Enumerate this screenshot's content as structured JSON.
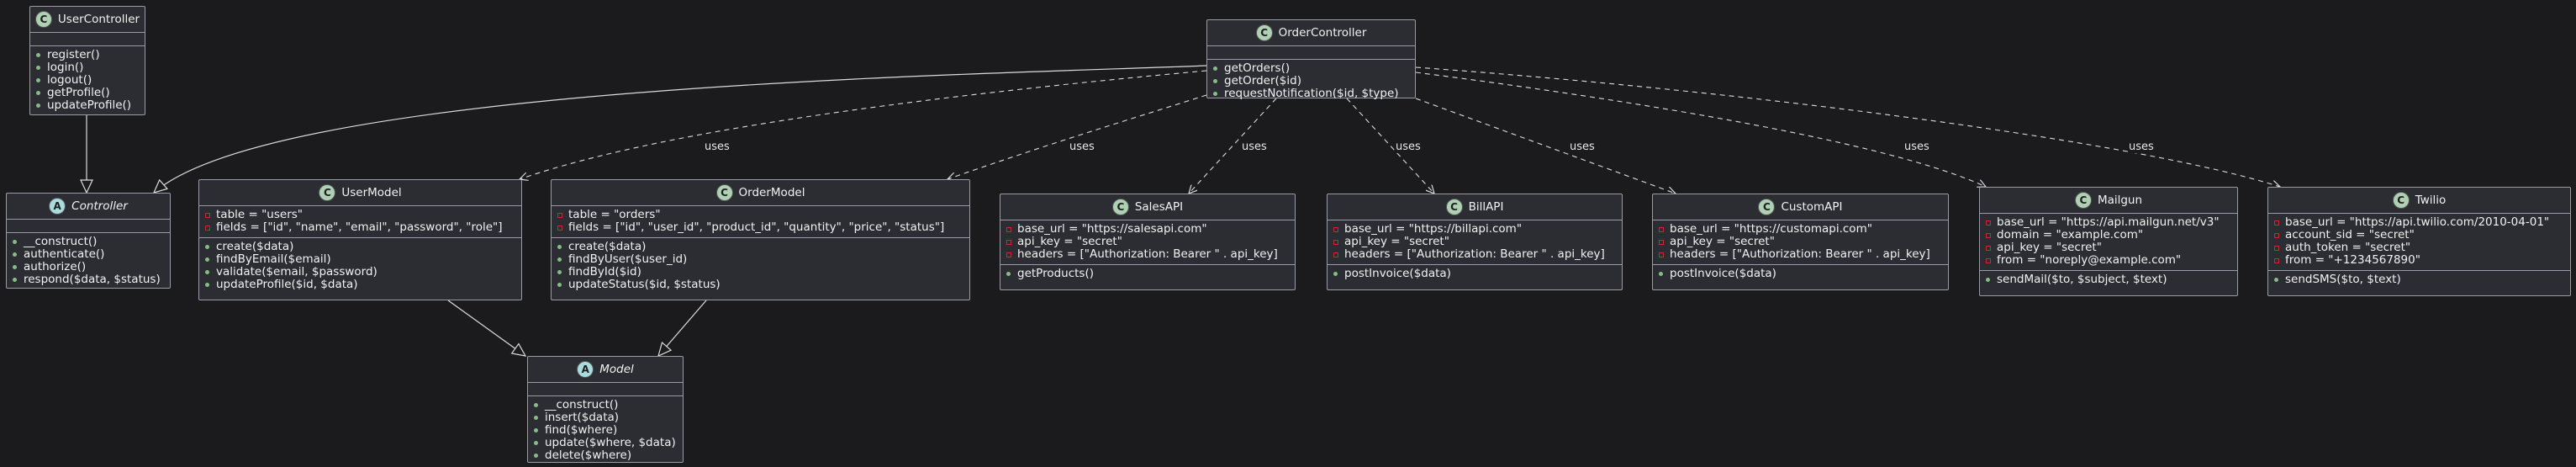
{
  "diagram": {
    "classes": {
      "user_controller": {
        "name": "UserController",
        "kind": "class",
        "fields": [],
        "methods": [
          {
            "vis": "public",
            "text": "register()"
          },
          {
            "vis": "public",
            "text": "login()"
          },
          {
            "vis": "public",
            "text": "logout()"
          },
          {
            "vis": "public",
            "text": "getProfile()"
          },
          {
            "vis": "public",
            "text": "updateProfile()"
          }
        ]
      },
      "controller": {
        "name": "Controller",
        "kind": "abstract",
        "fields": [],
        "methods": [
          {
            "vis": "public",
            "text": "__construct()"
          },
          {
            "vis": "public",
            "text": "authenticate()"
          },
          {
            "vis": "public",
            "text": "authorize()"
          },
          {
            "vis": "public",
            "text": "respond($data, $status)"
          }
        ]
      },
      "order_controller": {
        "name": "OrderController",
        "kind": "class",
        "fields": [],
        "methods": [
          {
            "vis": "public",
            "text": "getOrders()"
          },
          {
            "vis": "public",
            "text": "getOrder($id)"
          },
          {
            "vis": "public",
            "text": "requestNotification($id, $type)"
          }
        ]
      },
      "user_model": {
        "name": "UserModel",
        "kind": "class",
        "fields": [
          {
            "vis": "private",
            "text": "table = \"users\""
          },
          {
            "vis": "private",
            "text": "fields = [\"id\", \"name\", \"email\", \"password\", \"role\"]"
          }
        ],
        "methods": [
          {
            "vis": "public",
            "text": "create($data)"
          },
          {
            "vis": "public",
            "text": "findByEmail($email)"
          },
          {
            "vis": "public",
            "text": "validate($email, $password)"
          },
          {
            "vis": "public",
            "text": "updateProfile($id, $data)"
          }
        ]
      },
      "order_model": {
        "name": "OrderModel",
        "kind": "class",
        "fields": [
          {
            "vis": "private",
            "text": "table = \"orders\""
          },
          {
            "vis": "private",
            "text": "fields = [\"id\", \"user_id\", \"product_id\", \"quantity\", \"price\", \"status\"]"
          }
        ],
        "methods": [
          {
            "vis": "public",
            "text": "create($data)"
          },
          {
            "vis": "public",
            "text": "findByUser($user_id)"
          },
          {
            "vis": "public",
            "text": "findById($id)"
          },
          {
            "vis": "public",
            "text": "updateStatus($id, $status)"
          }
        ]
      },
      "model": {
        "name": "Model",
        "kind": "abstract",
        "fields": [],
        "methods": [
          {
            "vis": "public",
            "text": "__construct()"
          },
          {
            "vis": "public",
            "text": "insert($data)"
          },
          {
            "vis": "public",
            "text": "find($where)"
          },
          {
            "vis": "public",
            "text": "update($where, $data)"
          },
          {
            "vis": "public",
            "text": "delete($where)"
          }
        ]
      },
      "sales_api": {
        "name": "SalesAPI",
        "kind": "class",
        "fields": [
          {
            "vis": "private",
            "text": "base_url = \"https://salesapi.com\""
          },
          {
            "vis": "private",
            "text": "api_key = \"secret\""
          },
          {
            "vis": "private",
            "text": "headers = [\"Authorization: Bearer \" . api_key]"
          }
        ],
        "methods": [
          {
            "vis": "public",
            "text": "getProducts()"
          }
        ]
      },
      "bill_api": {
        "name": "BillAPI",
        "kind": "class",
        "fields": [
          {
            "vis": "private",
            "text": "base_url = \"https://billapi.com\""
          },
          {
            "vis": "private",
            "text": "api_key = \"secret\""
          },
          {
            "vis": "private",
            "text": "headers = [\"Authorization: Bearer \" . api_key]"
          }
        ],
        "methods": [
          {
            "vis": "public",
            "text": "postInvoice($data)"
          }
        ]
      },
      "custom_api": {
        "name": "CustomAPI",
        "kind": "class",
        "fields": [
          {
            "vis": "private",
            "text": "base_url = \"https://customapi.com\""
          },
          {
            "vis": "private",
            "text": "api_key = \"secret\""
          },
          {
            "vis": "private",
            "text": "headers = [\"Authorization: Bearer \" . api_key]"
          }
        ],
        "methods": [
          {
            "vis": "public",
            "text": "postInvoice($data)"
          }
        ]
      },
      "mailgun": {
        "name": "Mailgun",
        "kind": "class",
        "fields": [
          {
            "vis": "private",
            "text": "base_url = \"https://api.mailgun.net/v3\""
          },
          {
            "vis": "private",
            "text": "domain = \"example.com\""
          },
          {
            "vis": "private",
            "text": "api_key = \"secret\""
          },
          {
            "vis": "private",
            "text": "from = \"noreply@example.com\""
          }
        ],
        "methods": [
          {
            "vis": "public",
            "text": "sendMail($to, $subject, $text)"
          }
        ]
      },
      "twilio": {
        "name": "Twilio",
        "kind": "class",
        "fields": [
          {
            "vis": "private",
            "text": "base_url = \"https://api.twilio.com/2010-04-01\""
          },
          {
            "vis": "private",
            "text": "account_sid = \"secret\""
          },
          {
            "vis": "private",
            "text": "auth_token = \"secret\""
          },
          {
            "vis": "private",
            "text": "from = \"+1234567890\""
          }
        ],
        "methods": [
          {
            "vis": "public",
            "text": "sendSMS($to, $text)"
          }
        ]
      }
    },
    "relations": [
      {
        "type": "inheritance",
        "from": "user_controller",
        "to": "controller"
      },
      {
        "type": "inheritance",
        "from": "order_controller",
        "to": "controller"
      },
      {
        "type": "inheritance",
        "from": "user_model",
        "to": "model"
      },
      {
        "type": "inheritance",
        "from": "order_model",
        "to": "model"
      },
      {
        "type": "dependency",
        "from": "order_controller",
        "to": "user_model",
        "label": "uses"
      },
      {
        "type": "dependency",
        "from": "order_controller",
        "to": "order_model",
        "label": "uses"
      },
      {
        "type": "dependency",
        "from": "order_controller",
        "to": "sales_api",
        "label": "uses"
      },
      {
        "type": "dependency",
        "from": "order_controller",
        "to": "bill_api",
        "label": "uses"
      },
      {
        "type": "dependency",
        "from": "order_controller",
        "to": "custom_api",
        "label": "uses"
      },
      {
        "type": "dependency",
        "from": "order_controller",
        "to": "mailgun",
        "label": "uses"
      },
      {
        "type": "dependency",
        "from": "order_controller",
        "to": "twilio",
        "label": "uses"
      }
    ]
  }
}
